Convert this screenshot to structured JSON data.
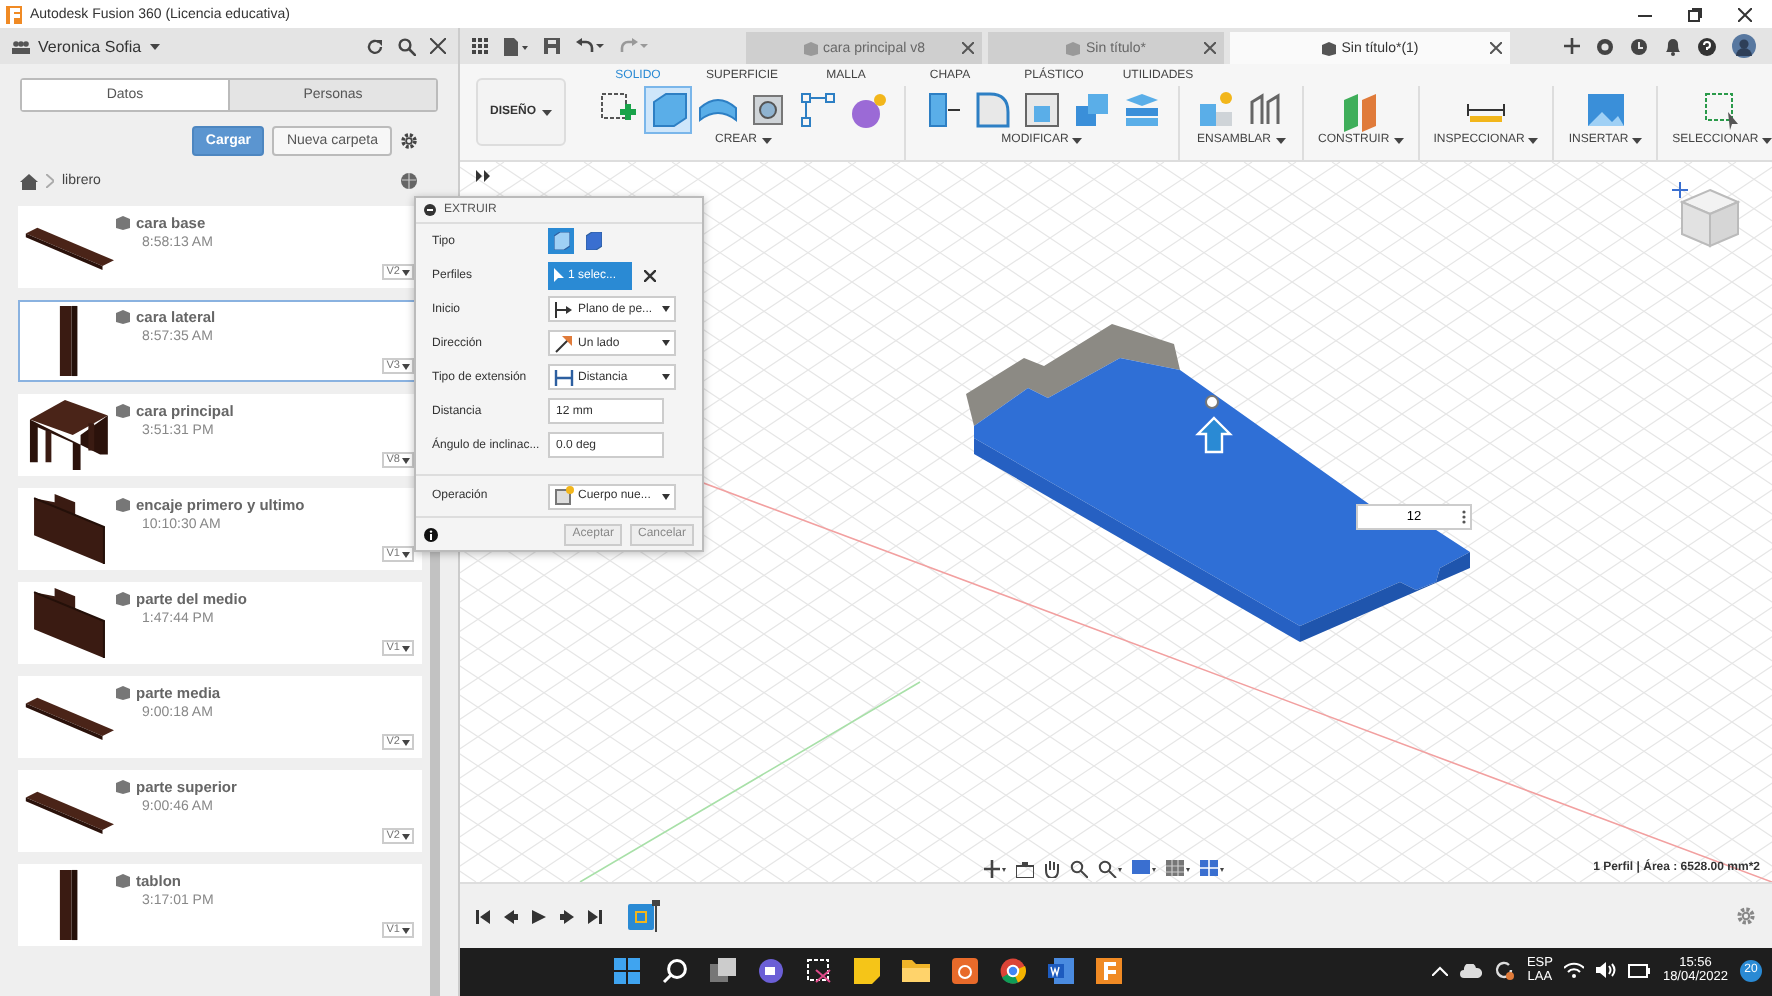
{
  "window": {
    "title": "Autodesk Fusion 360 (Licencia educativa)"
  },
  "user": {
    "name": "Veronica Sofia"
  },
  "doc_tabs": [
    {
      "label": "cara principal v8",
      "selected": false
    },
    {
      "label": "Sin título*",
      "selected": false
    },
    {
      "label": "Sin título*(1)",
      "selected": true
    }
  ],
  "panel": {
    "tabs": [
      {
        "label": "Datos",
        "selected": true
      },
      {
        "label": "Personas",
        "selected": false
      }
    ],
    "upload_button": "Cargar",
    "new_folder_button": "Nueva carpeta",
    "breadcrumb": "librero",
    "files": [
      {
        "name": "cara base",
        "time": "8:58:13 AM",
        "version": "V2",
        "selected": false,
        "kind": "plank"
      },
      {
        "name": "cara lateral",
        "time": "8:57:35 AM",
        "version": "V3",
        "selected": true,
        "kind": "post"
      },
      {
        "name": "cara principal",
        "time": "3:51:31 PM",
        "version": "V8",
        "selected": false,
        "kind": "table"
      },
      {
        "name": "encaje primero y ultimo",
        "time": "10:10:30 AM",
        "version": "V1",
        "selected": false,
        "kind": "block"
      },
      {
        "name": "parte del medio",
        "time": "1:47:44 PM",
        "version": "V1",
        "selected": false,
        "kind": "block"
      },
      {
        "name": "parte media",
        "time": "9:00:18 AM",
        "version": "V2",
        "selected": false,
        "kind": "plank"
      },
      {
        "name": "parte superior",
        "time": "9:00:46 AM",
        "version": "V2",
        "selected": false,
        "kind": "plank"
      },
      {
        "name": "tablon",
        "time": "3:17:01 PM",
        "version": "V1",
        "selected": false,
        "kind": "post"
      }
    ]
  },
  "toolbar": {
    "workspace": "DISEÑO",
    "tabs": [
      {
        "label": "SOLIDO",
        "selected": true
      },
      {
        "label": "SUPERFICIE",
        "selected": false
      },
      {
        "label": "MALLA",
        "selected": false
      },
      {
        "label": "CHAPA",
        "selected": false
      },
      {
        "label": "PLÁSTICO",
        "selected": false
      },
      {
        "label": "UTILIDADES",
        "selected": false
      }
    ],
    "groups": [
      {
        "label": "CREAR",
        "tools": [
          {
            "kind": "sketch",
            "selected": false
          },
          {
            "kind": "extrude",
            "selected": true
          },
          {
            "kind": "revolve",
            "selected": false
          },
          {
            "kind": "hole",
            "selected": false
          },
          {
            "kind": "pattern",
            "selected": false
          },
          {
            "kind": "form",
            "selected": false
          }
        ]
      },
      {
        "label": "MODIFICAR",
        "tools": [
          {
            "kind": "pushpull",
            "selected": false
          },
          {
            "kind": "fillet",
            "selected": false
          },
          {
            "kind": "shell",
            "selected": false
          },
          {
            "kind": "combine",
            "selected": false
          },
          {
            "kind": "split",
            "selected": false
          }
        ]
      },
      {
        "label": "ENSAMBLAR",
        "tools": [
          {
            "kind": "component",
            "selected": false
          },
          {
            "kind": "joint",
            "selected": false
          }
        ]
      },
      {
        "label": "CONSTRUIR",
        "tools": [
          {
            "kind": "plane",
            "selected": false
          }
        ]
      },
      {
        "label": "INSPECCIONAR",
        "tools": [
          {
            "kind": "measure",
            "selected": false
          }
        ]
      },
      {
        "label": "INSERTAR",
        "tools": [
          {
            "kind": "image",
            "selected": false
          }
        ]
      },
      {
        "label": "SELECCIONAR",
        "tools": [
          {
            "kind": "select",
            "selected": false
          }
        ]
      }
    ]
  },
  "dialog": {
    "title": "EXTRUIR",
    "rows": [
      {
        "label": "Tipo",
        "kind": "type",
        "options": [
          {
            "selected": true
          },
          {
            "selected": false
          }
        ]
      },
      {
        "label": "Perfiles",
        "kind": "select",
        "value": "1 selec..."
      },
      {
        "label": "Inicio",
        "kind": "dropdown",
        "value": "Plano de pe..."
      },
      {
        "label": "Dirección",
        "kind": "dropdown",
        "value": "Un lado"
      },
      {
        "label": "Tipo de extensión",
        "kind": "dropdown",
        "value": "Distancia"
      },
      {
        "label": "Distancia",
        "kind": "input",
        "value": "12 mm"
      },
      {
        "label": "Ángulo de inclinac...",
        "kind": "input",
        "value": "0.0 deg"
      },
      {
        "label": "Operación",
        "kind": "dropdown",
        "value": "Cuerpo nue..."
      }
    ],
    "ok_button": "Aceptar",
    "cancel_button": "Cancelar"
  },
  "canvas": {
    "dimension": "12",
    "status": "1 Perfil | Área : 6528.00 mm*2"
  },
  "taskbar": {
    "language": "ESP",
    "region": "LAA",
    "time": "15:56",
    "date": "18/04/2022",
    "notifications": "20"
  }
}
